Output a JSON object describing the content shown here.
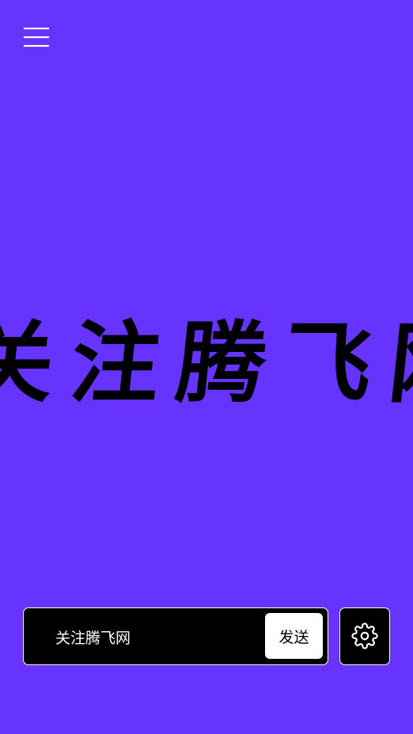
{
  "colors": {
    "background": "#6633ff",
    "marquee_text": "#000000",
    "bar_background": "#000000",
    "bar_border": "#ffffff",
    "send_button_background": "#ffffff",
    "send_button_text": "#000000",
    "icon": "#ffffff"
  },
  "header": {
    "menu_icon": "hamburger-menu-icon"
  },
  "marquee": {
    "text": "关注腾飞网"
  },
  "composer": {
    "message_value": "关注腾飞网",
    "send_label": "发送"
  },
  "settings": {
    "icon": "gear-icon"
  }
}
